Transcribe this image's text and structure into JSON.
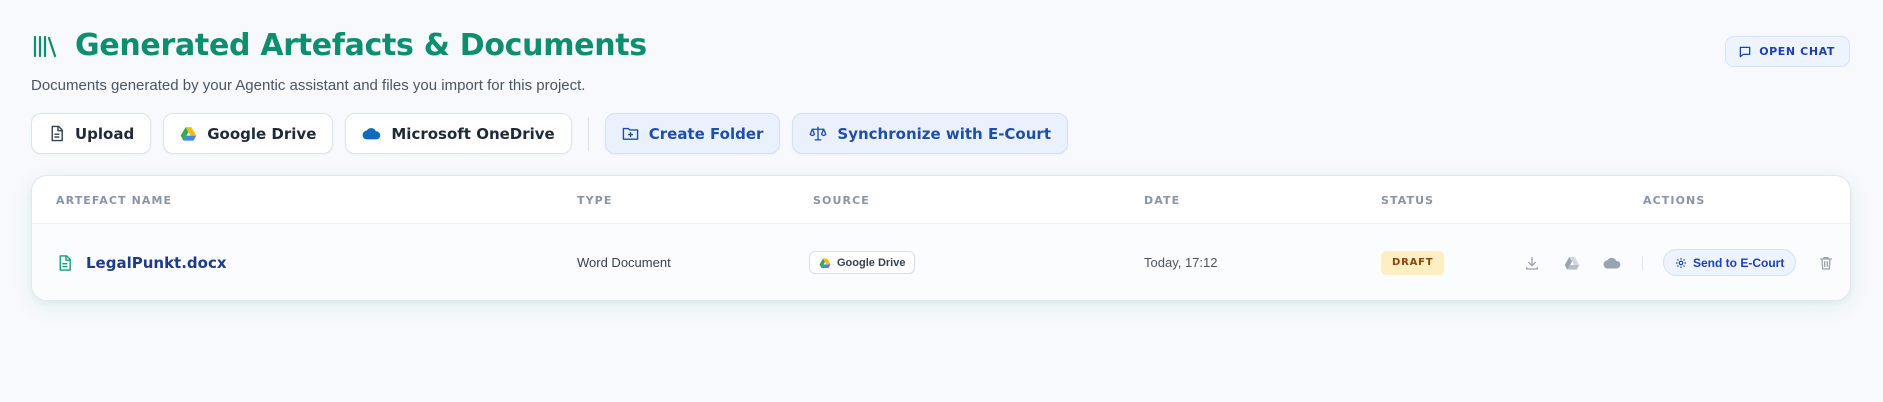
{
  "header": {
    "title": "Generated Artefacts & Documents",
    "subtitle": "Documents generated by your Agentic assistant and files you import for this project."
  },
  "open_chat_label": "OPEN CHAT",
  "toolbar": {
    "upload": "Upload",
    "google_drive": "Google Drive",
    "onedrive": "Microsoft OneDrive",
    "create_folder": "Create Folder",
    "sync_ecourt": "Synchronize with E-Court"
  },
  "table": {
    "columns": [
      "ARTEFACT NAME",
      "TYPE",
      "SOURCE",
      "DATE",
      "STATUS",
      "ACTIONS"
    ],
    "rows": [
      {
        "name": "LegalPunkt.docx",
        "type": "Word Document",
        "source": "Google Drive",
        "date": "Today, 17:12",
        "status": "DRAFT",
        "send_label": "Send to E-Court"
      }
    ]
  },
  "icons": {
    "title": "library-icon",
    "open_chat": "message-square-icon",
    "upload": "file-icon",
    "google_drive": "google-drive-icon",
    "onedrive": "cloud-icon",
    "create_folder": "folder-plus-icon",
    "sync": "scales-icon",
    "row_file": "file-text-icon",
    "download": "download-icon",
    "send": "gear-icon",
    "delete": "trash-icon"
  },
  "colors": {
    "brand": "#0d8f6f",
    "link": "#1e40af",
    "status_draft_bg": "#fdefc1",
    "status_draft_text": "#92400e"
  }
}
